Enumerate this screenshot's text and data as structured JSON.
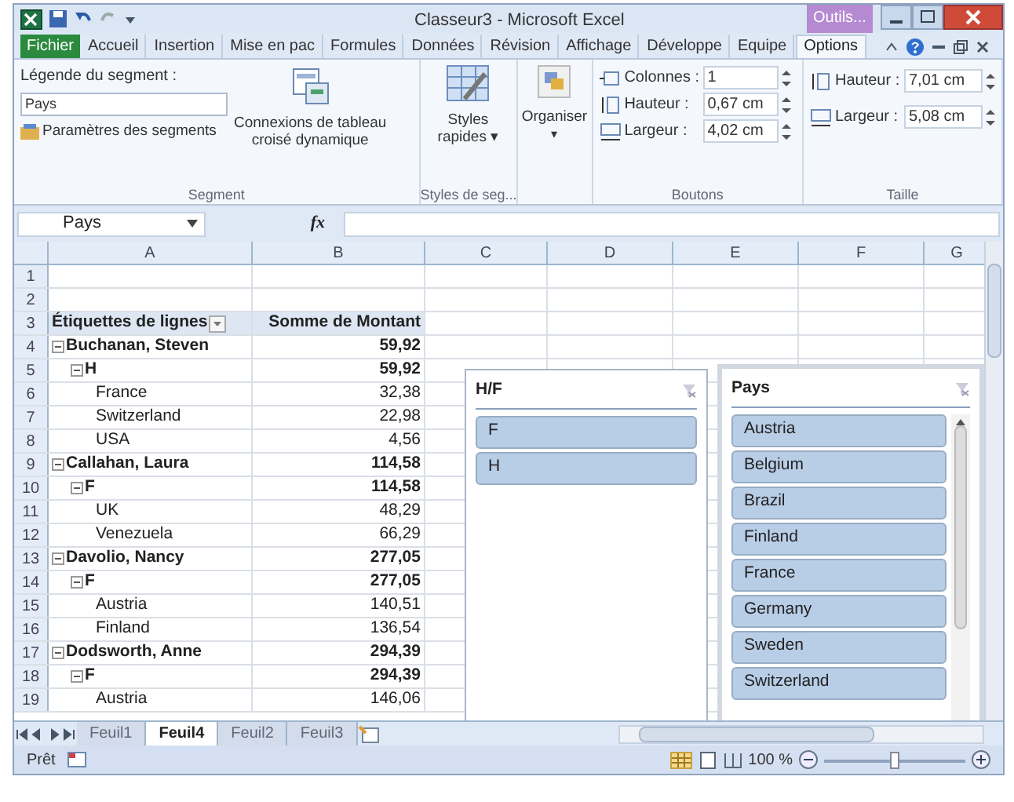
{
  "window": {
    "title": "Classeur3 - Microsoft Excel",
    "context_tab": "Outils..."
  },
  "ribbon_tabs": [
    {
      "label": "Fichier",
      "kind": "file",
      "selected": false
    },
    {
      "label": "Accueil",
      "kind": "tab",
      "selected": false
    },
    {
      "label": "Insertion",
      "kind": "tab",
      "selected": false
    },
    {
      "label": "Mise en pac",
      "kind": "tab",
      "selected": false
    },
    {
      "label": "Formules",
      "kind": "tab",
      "selected": false
    },
    {
      "label": "Données",
      "kind": "tab",
      "selected": false
    },
    {
      "label": "Révision",
      "kind": "tab",
      "selected": false
    },
    {
      "label": "Affichage",
      "kind": "tab",
      "selected": false
    },
    {
      "label": "Développe",
      "kind": "tab",
      "selected": false
    },
    {
      "label": "Equipe",
      "kind": "tab",
      "selected": false
    },
    {
      "label": "Options",
      "kind": "tab",
      "selected": true
    }
  ],
  "ribbon": {
    "caption_label": "Légende du segment :",
    "caption_value": "Pays",
    "settings_button": "Paramètres des segments",
    "connections_button": [
      "Connexions de tableau",
      "croisé dynamique"
    ],
    "segment_group": "Segment",
    "styles_button": [
      "Styles",
      "rapides ▾"
    ],
    "styles_group": "Styles de seg...",
    "arrange_button": "Organiser",
    "arrange_caret": "▾",
    "buttons_fields": [
      {
        "label": "Colonnes :",
        "value": "1"
      },
      {
        "label": "Hauteur :",
        "value": "0,67 cm"
      },
      {
        "label": "Largeur :",
        "value": "4,02 cm"
      }
    ],
    "buttons_group": "Boutons",
    "size_fields": [
      {
        "label": "Hauteur :",
        "value": "7,01 cm"
      },
      {
        "label": "Largeur :",
        "value": "5,08 cm"
      }
    ],
    "size_group": "Taille"
  },
  "formula_bar": {
    "name_box": "Pays",
    "fx": "fx"
  },
  "columns": [
    "A",
    "B",
    "C",
    "D",
    "E",
    "F",
    "G"
  ],
  "rows": [
    {
      "num": "1",
      "kind": "empty"
    },
    {
      "num": "2",
      "kind": "empty"
    },
    {
      "num": "3",
      "kind": "header",
      "label": "Étiquettes de lignes",
      "value": "Somme de Montant"
    },
    {
      "num": "4",
      "kind": "group",
      "label": "Buchanan, Steven",
      "value": "59,92"
    },
    {
      "num": "5",
      "kind": "subgroup",
      "label": "H",
      "value": "59,92"
    },
    {
      "num": "6",
      "kind": "item",
      "label": "France",
      "value": "32,38"
    },
    {
      "num": "7",
      "kind": "item",
      "label": "Switzerland",
      "value": "22,98"
    },
    {
      "num": "8",
      "kind": "item",
      "label": "USA",
      "value": "4,56"
    },
    {
      "num": "9",
      "kind": "group",
      "label": "Callahan, Laura",
      "value": "114,58"
    },
    {
      "num": "10",
      "kind": "subgroup",
      "label": "F",
      "value": "114,58"
    },
    {
      "num": "11",
      "kind": "item",
      "label": "UK",
      "value": "48,29"
    },
    {
      "num": "12",
      "kind": "item",
      "label": "Venezuela",
      "value": "66,29"
    },
    {
      "num": "13",
      "kind": "group",
      "label": "Davolio, Nancy",
      "value": "277,05"
    },
    {
      "num": "14",
      "kind": "subgroup",
      "label": "F",
      "value": "277,05"
    },
    {
      "num": "15",
      "kind": "item",
      "label": "Austria",
      "value": "140,51"
    },
    {
      "num": "16",
      "kind": "item",
      "label": "Finland",
      "value": "136,54"
    },
    {
      "num": "17",
      "kind": "group",
      "label": "Dodsworth, Anne",
      "value": "294,39"
    },
    {
      "num": "18",
      "kind": "subgroup",
      "label": "F",
      "value": "294,39"
    },
    {
      "num": "19",
      "kind": "item",
      "label": "Austria",
      "value": "146,06"
    }
  ],
  "slicers": [
    {
      "title": "H/F",
      "scroll": false,
      "items": [
        "F",
        "H"
      ]
    },
    {
      "title": "Pays",
      "scroll": true,
      "items": [
        "Austria",
        "Belgium",
        "Brazil",
        "Finland",
        "France",
        "Germany",
        "Sweden",
        "Switzerland"
      ]
    }
  ],
  "sheet_tabs": [
    {
      "label": "Feuil1",
      "selected": false
    },
    {
      "label": "Feuil4",
      "selected": true
    },
    {
      "label": "Feuil2",
      "selected": false
    },
    {
      "label": "Feuil3",
      "selected": false
    }
  ],
  "status_bar": {
    "state": "Prêt",
    "zoom": "100 %",
    "zoom_slider": {
      "level": 0.5
    }
  }
}
